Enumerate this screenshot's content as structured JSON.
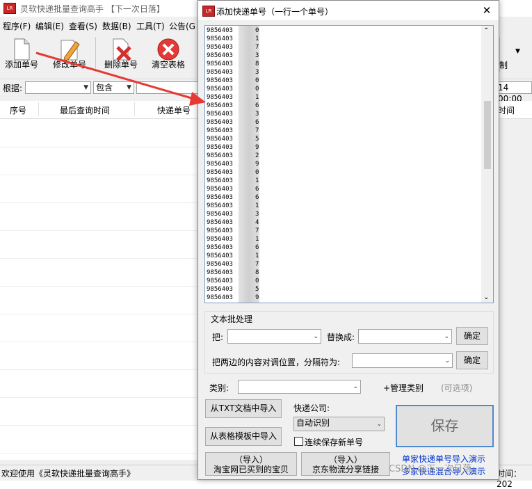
{
  "main": {
    "title": "灵软快递批量查询高手 【下一次日落】",
    "menus": [
      "程序(F)",
      "编辑(E)",
      "查看(S)",
      "数据(B)",
      "工具(T)",
      "公告(G"
    ],
    "toolbar": [
      "添加单号",
      "修改单号",
      "删除单号",
      "清空表格"
    ],
    "toolbar_right_partial": "制",
    "filter_label": "根据:",
    "filter_mode": "包含",
    "date_partial": "14 00:00",
    "columns": [
      "序号",
      "最后查询时间",
      "快递单号"
    ],
    "right_column_partial": "时间",
    "status_left": "欢迎使用《灵软快递批量查询高手》",
    "status_right_partial": "时间：202"
  },
  "dialog": {
    "title": "添加快递单号（一行一个单号）",
    "number_prefix": "9856403",
    "number_suffixes": [
      "0",
      "1",
      "7",
      "3",
      "8",
      "3",
      "0",
      "0",
      "1",
      "6",
      "3",
      "6",
      "7",
      "5",
      "9",
      "2",
      "9",
      "0",
      "1",
      "6",
      "6",
      "1",
      "3",
      "4",
      "7",
      "1",
      "6",
      "1",
      "7",
      "8",
      "0",
      "5",
      "9"
    ],
    "batch_group_title": "文本批处理",
    "replace_from_label": "把:",
    "replace_to_label": "替换成:",
    "confirm_label": "确定",
    "swap_label": "把两边的内容对调位置，分隔符为:",
    "category_label": "类别:",
    "manage_category_label": "+管理类别",
    "optional_hint": "(可选项)",
    "import_txt_label": "从TXT文档中导入",
    "import_template_label": "从表格模板中导入",
    "courier_label": "快递公司:",
    "courier_value": "自动识别",
    "continuous_save_label": "连续保存新单号",
    "save_label": "保存",
    "import_taobao_line1": "（导入）",
    "import_taobao_line2": "淘宝网已买到的宝贝",
    "import_jd_line1": "（导入）",
    "import_jd_line2": "京东物流分享链接",
    "demo_link_1": "单家快递单号导入演示",
    "demo_link_2": "多家快递混合导入演示",
    "watermark": "CSDN @下一次日落"
  },
  "colors": {
    "arrow": "#e53935",
    "link": "#0033cc",
    "save_border": "#4f8ad0"
  }
}
